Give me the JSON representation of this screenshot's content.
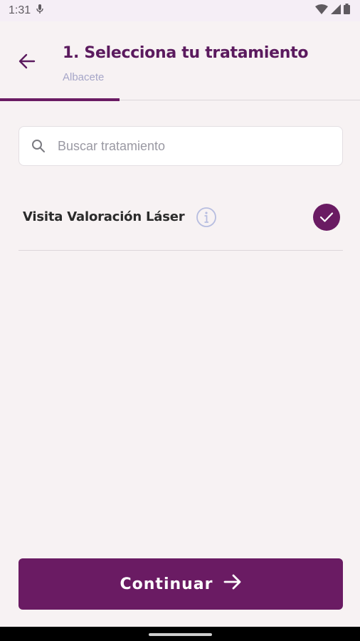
{
  "status_bar": {
    "time": "1:31",
    "icons": [
      "mic-icon",
      "wifi-icon",
      "signal-icon",
      "battery-icon"
    ]
  },
  "header": {
    "title": "1. Selecciona tu tratamiento",
    "subtitle": "Albacete",
    "back_icon": "arrow-left-icon"
  },
  "progress": {
    "fraction": 0.333
  },
  "search": {
    "placeholder": "Buscar tratamiento",
    "value": "",
    "icon": "search-icon"
  },
  "treatments": [
    {
      "label": "Visita Valoración Láser",
      "selected": true,
      "info_icon": "info-icon",
      "check_icon": "check-icon"
    }
  ],
  "footer": {
    "continue_label": "Continuar",
    "continue_icon": "arrow-right-icon"
  },
  "colors": {
    "primary": "#6a1b63",
    "title": "#5b1a5e",
    "subtitle": "#a6a6c8",
    "background": "#f7f2f3"
  }
}
